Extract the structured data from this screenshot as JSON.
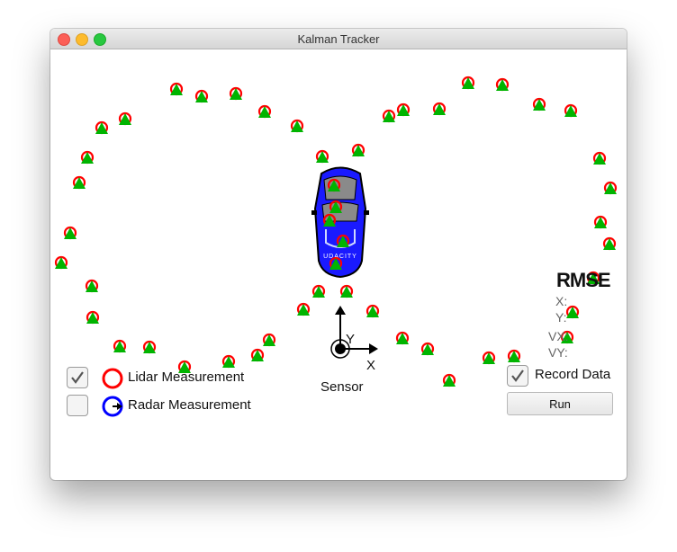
{
  "window": {
    "title": "Kalman Tracker"
  },
  "sensor": {
    "label": "Sensor",
    "x_axis": "X",
    "y_axis": "Y"
  },
  "legend": {
    "lidar": {
      "label": "Lidar Measurement",
      "checked": true
    },
    "radar": {
      "label": "Radar Measurement",
      "checked": false
    }
  },
  "rmse": {
    "title": "RMSE",
    "x": "X:",
    "y": "Y:",
    "vx": "VX:",
    "vy": "VY:"
  },
  "controls": {
    "record_label": "Record Data",
    "record_checked": true,
    "run_label": "Run"
  },
  "car": {
    "logo_text": "UDACITY"
  },
  "colors": {
    "lidar": "#ff0000",
    "radar": "#0000ff",
    "estimate": "#00b400",
    "car_body": "#1a1aff"
  },
  "markers": [
    [
      196,
      101
    ],
    [
      224,
      109
    ],
    [
      262,
      106
    ],
    [
      294,
      126
    ],
    [
      330,
      142
    ],
    [
      139,
      134
    ],
    [
      113,
      144
    ],
    [
      97,
      177
    ],
    [
      88,
      205
    ],
    [
      78,
      261
    ],
    [
      68,
      294
    ],
    [
      102,
      320
    ],
    [
      103,
      355
    ],
    [
      133,
      387
    ],
    [
      166,
      388
    ],
    [
      205,
      410
    ],
    [
      254,
      404
    ],
    [
      286,
      397
    ],
    [
      299,
      380
    ],
    [
      337,
      346
    ],
    [
      354,
      326
    ],
    [
      385,
      326
    ],
    [
      414,
      348
    ],
    [
      447,
      378
    ],
    [
      475,
      390
    ],
    [
      499,
      425
    ],
    [
      543,
      400
    ],
    [
      571,
      398
    ],
    [
      630,
      377
    ],
    [
      636,
      349
    ],
    [
      659,
      311
    ],
    [
      677,
      273
    ],
    [
      667,
      249
    ],
    [
      678,
      211
    ],
    [
      666,
      178
    ],
    [
      634,
      125
    ],
    [
      599,
      118
    ],
    [
      558,
      96
    ],
    [
      520,
      94
    ],
    [
      488,
      123
    ],
    [
      448,
      124
    ],
    [
      432,
      131
    ],
    [
      398,
      169
    ],
    [
      358,
      176
    ],
    [
      371,
      208
    ],
    [
      373,
      232
    ],
    [
      366,
      247
    ],
    [
      381,
      270
    ],
    [
      373,
      295
    ]
  ]
}
